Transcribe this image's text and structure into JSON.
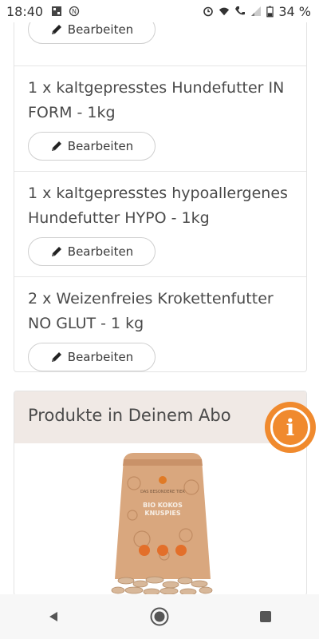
{
  "status_bar": {
    "time": "18:40",
    "battery": "34 %",
    "icons": [
      "gallery-icon",
      "nfc-icon",
      "alarm-icon",
      "wifi-icon",
      "phone-signal-icon",
      "cell-signal-icon",
      "battery-icon"
    ]
  },
  "order": {
    "edit_label": "Bearbeiten",
    "items": [
      {
        "title": "1 x kaltgepresstes Hundefutter IN FORM - 1kg"
      },
      {
        "title": "1 x kaltgepresstes hypoallergenes Hundefutter HYPO - 1kg"
      },
      {
        "title": "2 x Weizenfreies Krokettenfutter NO GLUT - 1 kg"
      }
    ]
  },
  "products": {
    "title": "Produkte in Deinem Abo",
    "product_bag": {
      "brand": "DAS BESONDERE TIER",
      "name_line1": "BIO KOKOS",
      "name_line2": "KNUSPIES"
    }
  },
  "colors": {
    "accent_orange": "#f08a2e",
    "panel_beige": "#f0e9e5",
    "text": "#4a4a4a"
  },
  "navbar": {
    "icons": [
      "back-icon",
      "home-icon",
      "recents-icon"
    ]
  }
}
